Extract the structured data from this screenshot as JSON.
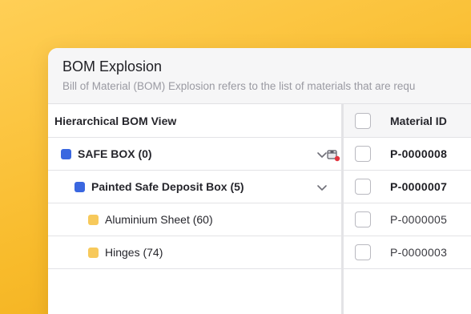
{
  "window": {
    "title": "BOM Explosion",
    "subtitle": "Bill of Material (BOM) Explosion refers to the list of materials that are requ"
  },
  "tree": {
    "header": "Hierarchical BOM View",
    "items": [
      {
        "label": "SAFE BOX (0)",
        "color": "#3a67e0"
      },
      {
        "label": "Painted Safe Deposit Box (5)",
        "color": "#3a67e0"
      },
      {
        "label": "Aluminium Sheet (60)",
        "color": "#f7c95b"
      },
      {
        "label": "Hinges (74)",
        "color": "#f7c95b"
      }
    ]
  },
  "table": {
    "header": "Material ID",
    "rows": [
      "P-0000008",
      "P-0000007",
      "P-0000005",
      "P-0000003"
    ]
  },
  "icons": {
    "expand": "chevron-down-icon",
    "box": "box-alert-icon",
    "status_dot": "#e2343f"
  }
}
